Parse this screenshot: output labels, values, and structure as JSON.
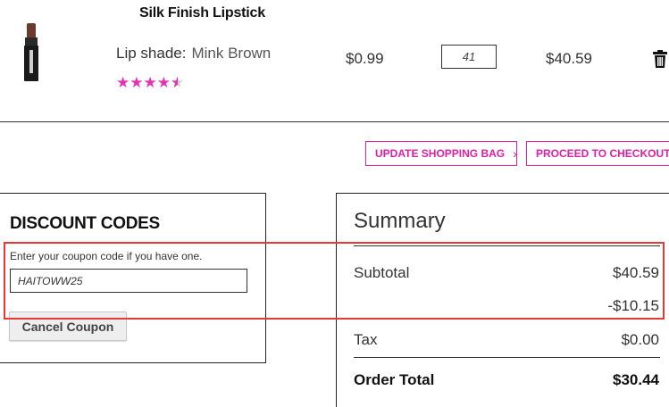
{
  "product": {
    "title": "Silk Finish Lipstick",
    "image_icon": "lipstick-product-image",
    "shade_label": "Lip shade:",
    "shade_value": "Mink Brown",
    "rating": 4.5,
    "rating_max": 5,
    "unit_price": "$0.99",
    "quantity": "41",
    "row_total": "$40.59",
    "delete_icon": "trash-icon"
  },
  "actions": {
    "update_label": "UPDATE SHOPPING BAG",
    "checkout_label": "PROCEED TO CHECKOUT",
    "chevron": "›"
  },
  "discount": {
    "title": "DISCOUNT CODES",
    "hint": "Enter your coupon code if you have one.",
    "coupon_value": "HAITOWW25",
    "cancel_label": "Cancel Coupon"
  },
  "summary": {
    "title": "Summary",
    "subtotal_label": "Subtotal",
    "subtotal_value": "$40.59",
    "discount_value": "-$10.15",
    "tax_label": "Tax",
    "tax_value": "$0.00",
    "total_label": "Order Total",
    "total_value": "$30.44"
  },
  "colors": {
    "accent": "#e01fa6",
    "star": "#e232b8",
    "highlight": "#e53935"
  }
}
